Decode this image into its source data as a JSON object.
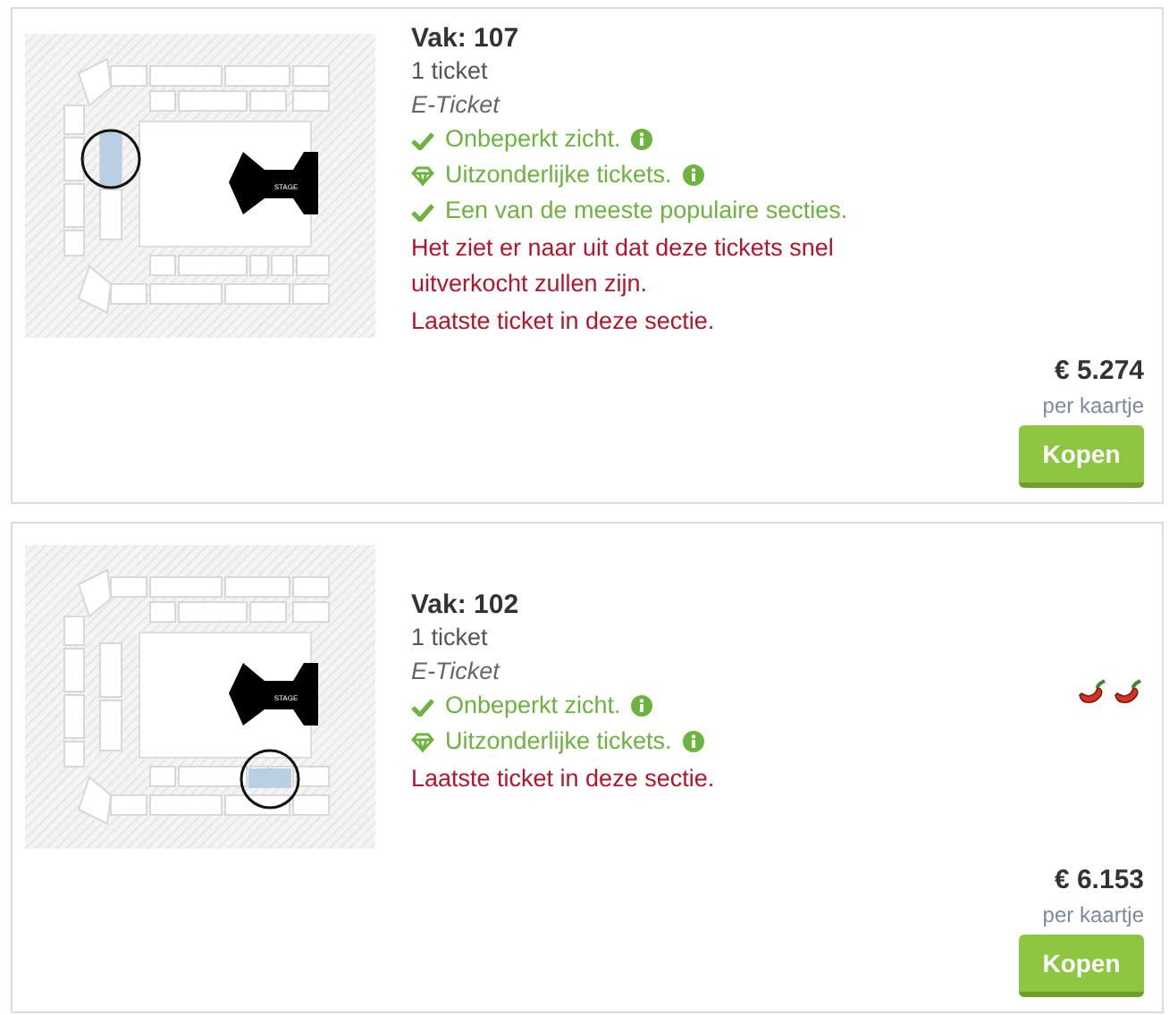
{
  "tickets": [
    {
      "section": "Vak: 107",
      "quantity": "1 ticket",
      "delivery": "E-Ticket",
      "map": {
        "stage_label": "STAGE",
        "kind": "left"
      },
      "features": [
        {
          "kind": "check",
          "text": "Onbeperkt zicht.",
          "info": true
        },
        {
          "kind": "diamond",
          "text": "Uitzonderlijke tickets.",
          "info": true
        },
        {
          "kind": "check",
          "text": "Een van de meeste populaire secties.",
          "info": false
        }
      ],
      "warnings": [
        "Het ziet er naar uit dat deze tickets snel uitverkocht zullen zijn.",
        "Laatste ticket in deze sectie."
      ],
      "price": "€ 5.274",
      "price_unit": "per kaartje",
      "button": "Kopen"
    },
    {
      "section": "Vak: 102",
      "quantity": "1 ticket",
      "delivery": "E-Ticket",
      "map": {
        "stage_label": "STAGE",
        "kind": "bottom"
      },
      "features": [
        {
          "kind": "check",
          "text": "Onbeperkt zicht.",
          "info": true
        },
        {
          "kind": "diamond",
          "text": "Uitzonderlijke tickets.",
          "info": true
        }
      ],
      "warnings": [
        "Laatste ticket in deze sectie."
      ],
      "badges": [
        {
          "kind": "chili"
        },
        {
          "kind": "chili"
        }
      ],
      "price": "€ 6.153",
      "price_unit": "per kaartje",
      "button": "Kopen"
    }
  ]
}
